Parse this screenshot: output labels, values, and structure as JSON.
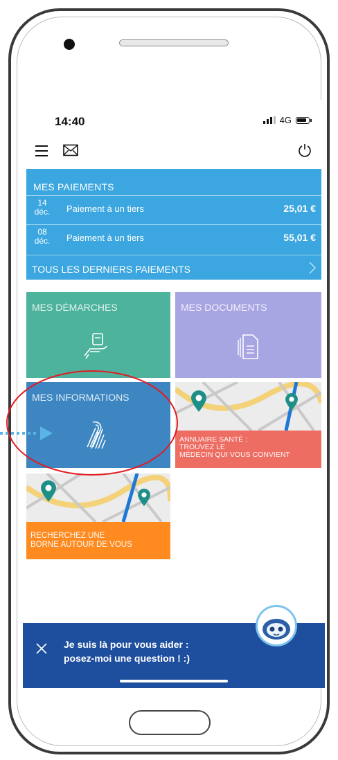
{
  "status_bar": {
    "time": "14:40",
    "network": "4G"
  },
  "icons": {
    "menu": "hamburger-menu-icon",
    "mail": "envelope-icon",
    "power": "power-icon",
    "demarches": "hand-document-icon",
    "documents": "documents-icon",
    "informations": "fingerprint-icon",
    "close": "close-icon",
    "chevron": "chevron-right-icon",
    "pin": "map-pin-icon"
  },
  "payments": {
    "title": "MES PAIEMENTS",
    "items": [
      {
        "day": "14",
        "month": "déc.",
        "label": "Paiement à un tiers",
        "amount": "25,01 €"
      },
      {
        "day": "08",
        "month": "déc.",
        "label": "Paiement à un tiers",
        "amount": "55,01 €"
      }
    ],
    "all_label": "TOUS LES DERNIERS PAIEMENTS"
  },
  "tiles": {
    "demarches": "MES DÉMARCHES",
    "documents": "MES DOCUMENTS",
    "informations": "MES INFORMATIONS",
    "annuaire": [
      "ANNUAIRE SANTÉ :",
      "TROUVEZ LE",
      "MÉDECIN QUI VOUS CONVIENT"
    ],
    "borne": [
      "RECHERCHEZ UNE",
      "BORNE AUTOUR DE VOUS"
    ]
  },
  "chat": {
    "line1": "Je suis là pour vous aider :",
    "line2": "posez-moi une question ! :)"
  },
  "colors": {
    "payments": "#3ba6df",
    "demarches": "#4db39c",
    "documents": "#a8a5e3",
    "informations": "#3d86c1",
    "annuaire": "#ee6d63",
    "borne": "#ff8a1f",
    "chat": "#1e4f9e",
    "highlight": "#e31b23",
    "pointer": "#5ab4e6"
  }
}
